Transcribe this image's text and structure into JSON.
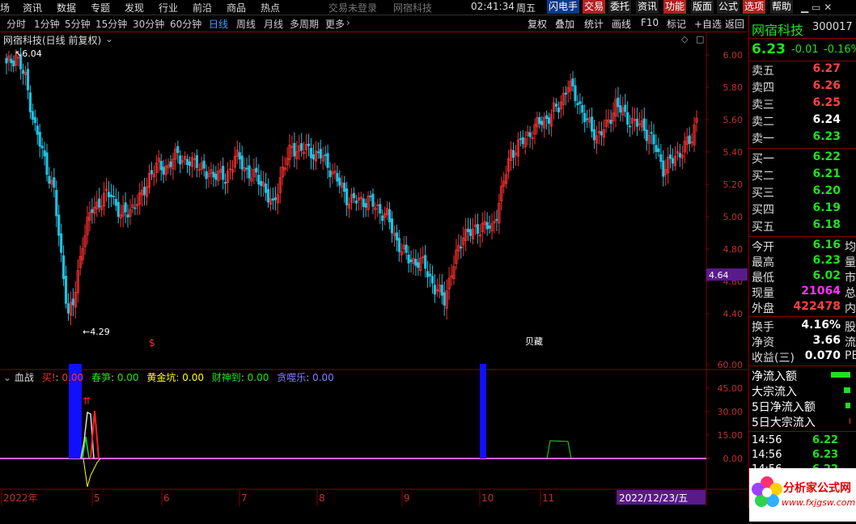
{
  "menu": {
    "items": [
      "场",
      "资讯",
      "数据",
      "专题",
      "发现",
      "行业",
      "前沿",
      "商品",
      "热点"
    ],
    "status_login": "交易未登录",
    "status_name": "网宿科技",
    "clock": "02:41:34",
    "weekday": "周五",
    "buttons": [
      "闪电手",
      "交易",
      "委托",
      "资讯",
      "功能",
      "版面",
      "公式",
      "选项",
      "帮助"
    ]
  },
  "period": {
    "tabs": [
      "分时",
      "1分钟",
      "5分钟",
      "15分钟",
      "30分钟",
      "60分钟",
      "日线",
      "周线",
      "月线",
      "多周期",
      "更多"
    ],
    "active": "日线",
    "tools": [
      "复权",
      "叠加",
      "统计",
      "画线",
      "F10",
      "标记",
      "+自选",
      "返回"
    ]
  },
  "chart_title": "网宿科技(日线 前复权)",
  "main_chart": {
    "y_ticks": [
      "6.00",
      "5.80",
      "5.60",
      "5.40",
      "5.20",
      "5.00",
      "4.80",
      "4.60",
      "4.40"
    ],
    "price_tag": "4.64",
    "high_label": "6.04",
    "low_label": "4.29",
    "buy_marker": "$",
    "sell_marker": "贝藏"
  },
  "indicator": {
    "name": "血战",
    "items": [
      {
        "label": "买!",
        "value": "0.00",
        "color": "#ff3030"
      },
      {
        "label": "春笋",
        "value": "0.00",
        "color": "#20e020"
      },
      {
        "label": "黄金坑",
        "value": "0.00",
        "color": "#ffff00"
      },
      {
        "label": "财神到",
        "value": "0.00",
        "color": "#20e020"
      },
      {
        "label": "贪噬乐",
        "value": "0.00",
        "color": "#8080ff"
      }
    ],
    "y_ticks": [
      "60.00",
      "45.00",
      "30.00",
      "15.00",
      "0.00"
    ]
  },
  "x_axis": {
    "labels": [
      "2022年",
      "5",
      "6",
      "7",
      "8",
      "9",
      "10",
      "11"
    ],
    "cursor_date": "2022/12/23/五"
  },
  "panel": {
    "name": "网宿科技",
    "code": "300017",
    "price": "6.23",
    "change": "-0.01",
    "pct": "-0.16%",
    "asks": [
      {
        "label": "卖五",
        "price": "6.27"
      },
      {
        "label": "卖四",
        "price": "6.26"
      },
      {
        "label": "卖三",
        "price": "6.25"
      },
      {
        "label": "卖二",
        "price": "6.24"
      },
      {
        "label": "卖一",
        "price": "6.23"
      }
    ],
    "bids": [
      {
        "label": "买一",
        "price": "6.22"
      },
      {
        "label": "买二",
        "price": "6.21"
      },
      {
        "label": "买三",
        "price": "6.20"
      },
      {
        "label": "买四",
        "price": "6.19"
      },
      {
        "label": "买五",
        "price": "6.18"
      }
    ],
    "stats": [
      {
        "label": "今开",
        "value": "6.16",
        "color": "green",
        "tail": "均"
      },
      {
        "label": "最高",
        "value": "6.23",
        "color": "green",
        "tail": "量"
      },
      {
        "label": "最低",
        "value": "6.02",
        "color": "green",
        "tail": "市"
      },
      {
        "label": "现量",
        "value": "21064",
        "color": "mag",
        "tail": "总"
      },
      {
        "label": "外盘",
        "value": "422478",
        "color": "red",
        "tail": "内"
      }
    ],
    "stats2": [
      {
        "label": "换手",
        "value": "4.16%",
        "tail": "股"
      },
      {
        "label": "净资",
        "value": "3.66",
        "tail": "流"
      },
      {
        "label": "收益(三)",
        "value": "0.070",
        "tail": "PE"
      }
    ],
    "flows": [
      {
        "label": "净流入额",
        "bar": 34
      },
      {
        "label": "大宗流入",
        "bar": 12
      },
      {
        "label": "5日净流入额",
        "bar": 8
      },
      {
        "label": "5日大宗流入",
        "bar": 2
      }
    ],
    "ticks": [
      {
        "time": "14:56",
        "price": "6.22"
      },
      {
        "time": "14:56",
        "price": "6.23"
      },
      {
        "time": "14:56",
        "price": "6.22"
      },
      {
        "time": "14:56",
        "price": "6.23"
      }
    ],
    "logo_text": "分析家公式网",
    "logo_url": "www.fxjgsw.com"
  },
  "colors": {
    "up": "#ff3030",
    "down": "#20c0e0",
    "panel_border": "#800000",
    "accent": "#3aa0ff"
  }
}
